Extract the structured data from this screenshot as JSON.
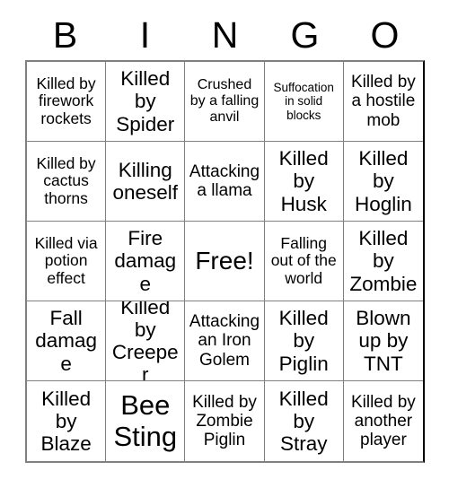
{
  "card": {
    "title": "BINGO",
    "header_letters": [
      "B",
      "I",
      "N",
      "G",
      "O"
    ],
    "grid_size": "5x5",
    "colors": {
      "background": "#ffffff",
      "text": "#000000",
      "grid_line": "#808080",
      "grid_outer": "#000000"
    },
    "cells": [
      [
        {
          "text": "Killed by firework rockets",
          "size": "fs-sm",
          "free": false
        },
        {
          "text": "Killed by Spider",
          "size": "fs-lg",
          "free": false
        },
        {
          "text": "Crushed by a falling anvil",
          "size": "fs-xs",
          "free": false
        },
        {
          "text": "Suffocation in solid blocks",
          "size": "fs-xxs",
          "free": false
        },
        {
          "text": "Killed by a hostile mob",
          "size": "fs-md",
          "free": false
        }
      ],
      [
        {
          "text": "Killed by cactus thorns",
          "size": "fs-sm",
          "free": false
        },
        {
          "text": "Killing oneself",
          "size": "fs-lg",
          "free": false
        },
        {
          "text": "Attacking a llama",
          "size": "fs-md",
          "free": false
        },
        {
          "text": "Killed by Husk",
          "size": "fs-lg",
          "free": false
        },
        {
          "text": "Killed by Hoglin",
          "size": "fs-lg",
          "free": false
        }
      ],
      [
        {
          "text": "Killed via potion effect",
          "size": "fs-sm",
          "free": false
        },
        {
          "text": "Fire damage",
          "size": "fs-lg",
          "free": false
        },
        {
          "text": "Free!",
          "size": "fs-xl",
          "free": true
        },
        {
          "text": "Falling out of the world",
          "size": "fs-sm",
          "free": false
        },
        {
          "text": "Killed by Zombie",
          "size": "fs-lg",
          "free": false
        }
      ],
      [
        {
          "text": "Fall damage",
          "size": "fs-lg",
          "free": false
        },
        {
          "text": "Killed by Creeper",
          "size": "fs-lg",
          "free": false
        },
        {
          "text": "Attacking an Iron Golem",
          "size": "fs-md",
          "free": false
        },
        {
          "text": "Killed by Piglin",
          "size": "fs-lg",
          "free": false
        },
        {
          "text": "Blown up by TNT",
          "size": "fs-lg",
          "free": false
        }
      ],
      [
        {
          "text": "Killed by Blaze",
          "size": "fs-lg",
          "free": false
        },
        {
          "text": "Bee Sting",
          "size": "fs-xxl",
          "free": false
        },
        {
          "text": "Killed by Zombie Piglin",
          "size": "fs-md",
          "free": false
        },
        {
          "text": "Killed by Stray",
          "size": "fs-lg",
          "free": false
        },
        {
          "text": "Killed by another player",
          "size": "fs-md",
          "free": false
        }
      ]
    ]
  }
}
